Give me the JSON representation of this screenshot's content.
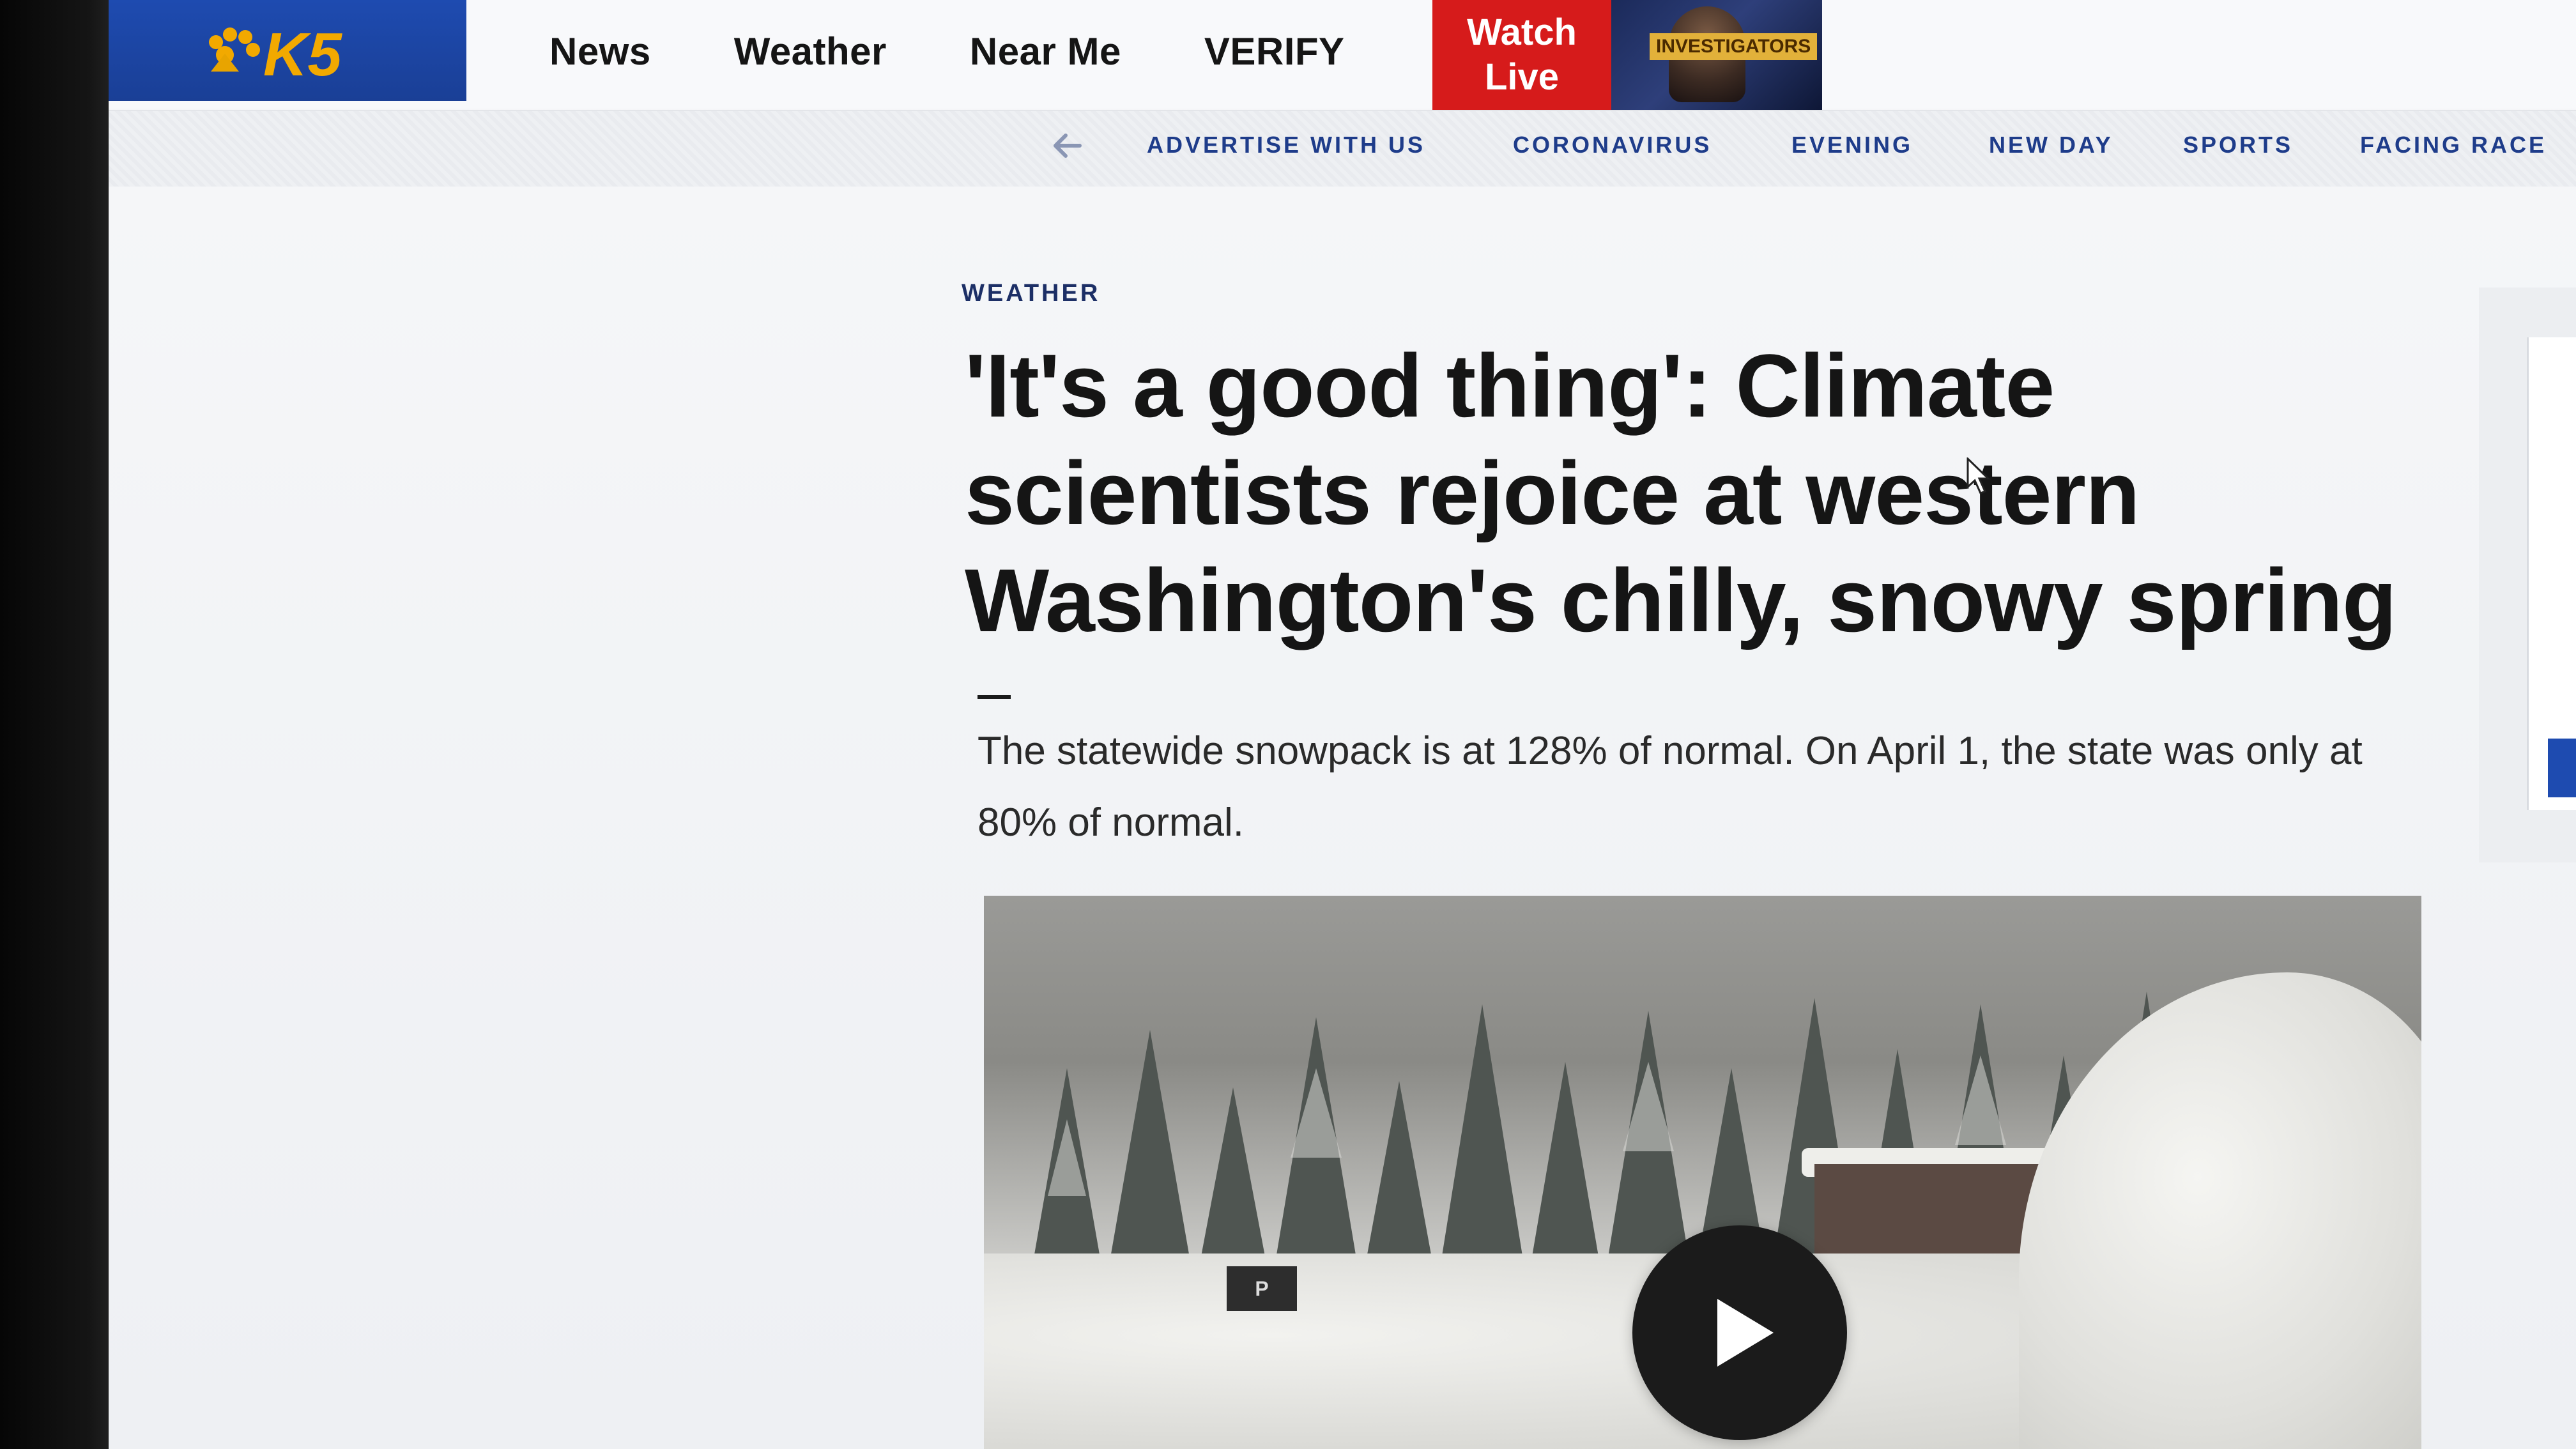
{
  "header": {
    "logo_text": "K5",
    "nav": [
      "News",
      "Weather",
      "Near Me",
      "VERIFY"
    ],
    "watch_live": {
      "line1": "Watch",
      "line2": "Live"
    },
    "live_thumbnail_tag": "INVESTIGATORS",
    "brand_color": "#1e4bb0",
    "live_color": "#d61b1b"
  },
  "secondary_nav": {
    "back_icon": "arrow-left-icon",
    "items": [
      "ADVERTISE WITH US",
      "CORONAVIRUS",
      "EVENING",
      "NEW DAY",
      "SPORTS",
      "FACING RACE"
    ],
    "link_color": "#1e3c8a"
  },
  "article": {
    "category": "WEATHER",
    "headline": "'It's a good thing': Climate scientists rejoice at western Washington's chilly, snowy spring",
    "subhead": "The statewide snowpack is at 128% of normal. On April 1, the state was only at 80% of normal."
  },
  "video": {
    "parking_sign": "P",
    "play_icon": "play-icon"
  },
  "right_rail": {
    "button_icon": "share-icon"
  }
}
